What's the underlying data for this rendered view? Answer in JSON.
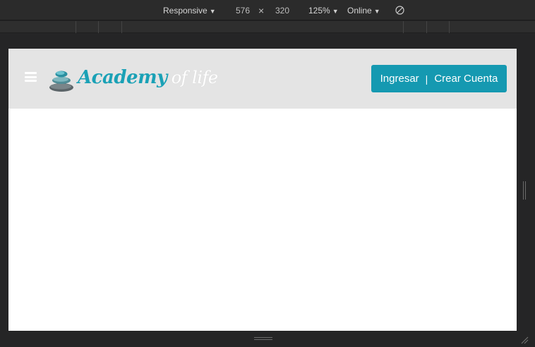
{
  "devtools": {
    "device_mode": "Responsive",
    "width": "576",
    "times": "×",
    "height": "320",
    "zoom": "125%",
    "network": "Online",
    "rotate_icon": "rotate-icon"
  },
  "site": {
    "menu_icon": "hamburger-menu-icon",
    "logo_icon": "stacked-stones-icon",
    "logo_word1": "Academy",
    "logo_word2": "of life",
    "login_label": "Ingresar",
    "separator": "|",
    "signup_label": "Crear Cuenta",
    "accent_color": "#1599b1",
    "header_bg": "#e4e4e4"
  }
}
